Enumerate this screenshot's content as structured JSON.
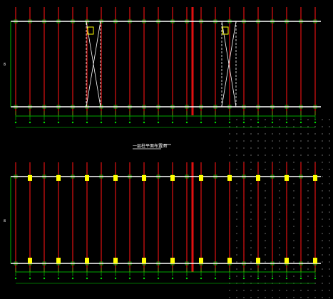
{
  "drawing": {
    "background": "#000000",
    "colors": {
      "column_red": "#e01010",
      "beam_white": "#ffffff",
      "dimension_green": "#00e000",
      "bracing_white": "#ffffff",
      "highlight_yellow": "#ffff00",
      "grid_dots": "#bbbbbb"
    },
    "upper_plan": {
      "column_count": 22,
      "bracing_bays": 2,
      "section_title": "一层柱平面布置图"
    },
    "lower_plan": {
      "column_count": 22,
      "plate_markers": "yellow",
      "section_title": ""
    },
    "labels": {
      "left_dimension_upper": "8",
      "left_dimension_lower": "8",
      "scale_mark": "1:100"
    }
  }
}
